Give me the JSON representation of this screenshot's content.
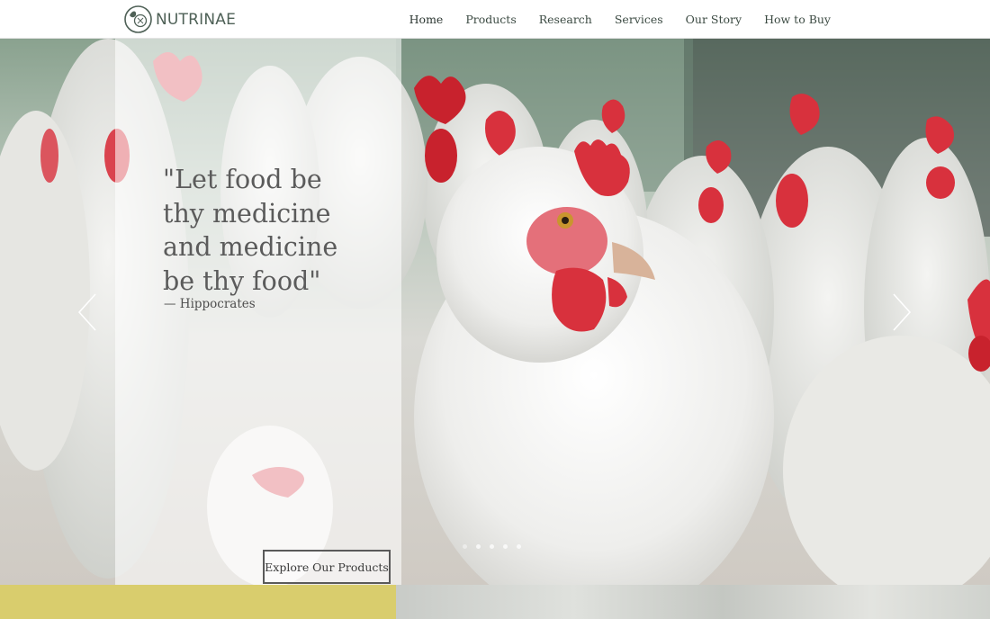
{
  "brand": {
    "name": "NUTRINAE",
    "logo_icon": "leaf-circle-logo-icon",
    "color": "#4f6157"
  },
  "nav": {
    "items": [
      {
        "label": "Home",
        "active": true
      },
      {
        "label": "Products"
      },
      {
        "label": "Research"
      },
      {
        "label": "Services"
      },
      {
        "label": "Our Story"
      },
      {
        "label": "How to Buy"
      }
    ]
  },
  "hero": {
    "quote": "\"Let food be\nthy medicine\nand medicine\nbe thy food\"",
    "author": "— Hippocrates",
    "cta_label": "Explore Our Products",
    "prev_icon": "chevron-left-icon",
    "next_icon": "chevron-right-icon",
    "slides_count": 5,
    "active_slide": 1
  },
  "colors": {
    "accent_yellow": "#d9cd6d",
    "quote_text": "#5b5b5b",
    "comb_red": "#d8313d"
  }
}
